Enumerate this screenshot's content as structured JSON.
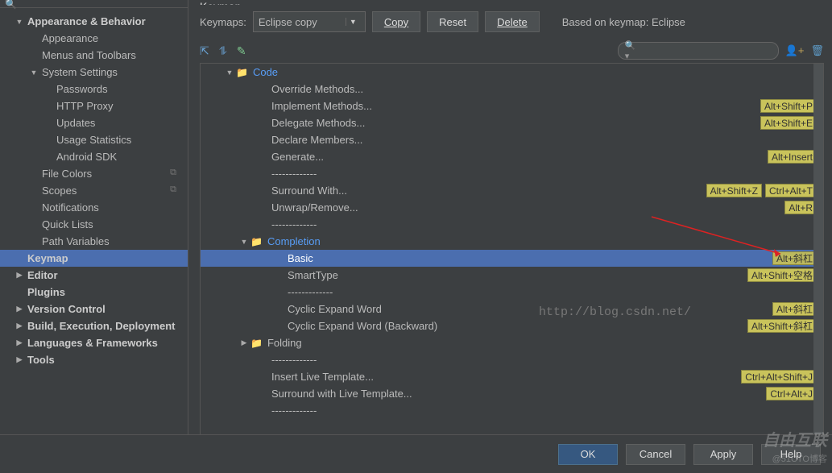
{
  "header": {
    "title": "Keymap"
  },
  "search": {
    "placeholder": ""
  },
  "sidebar": {
    "items": [
      {
        "label": "Appearance & Behavior",
        "indent": 0,
        "arrow": "▼",
        "bold": true
      },
      {
        "label": "Appearance",
        "indent": 1
      },
      {
        "label": "Menus and Toolbars",
        "indent": 1
      },
      {
        "label": "System Settings",
        "indent": 1,
        "arrow": "▼"
      },
      {
        "label": "Passwords",
        "indent": 2
      },
      {
        "label": "HTTP Proxy",
        "indent": 2
      },
      {
        "label": "Updates",
        "indent": 2
      },
      {
        "label": "Usage Statistics",
        "indent": 2
      },
      {
        "label": "Android SDK",
        "indent": 2
      },
      {
        "label": "File Colors",
        "indent": 1,
        "suffix": "⧉"
      },
      {
        "label": "Scopes",
        "indent": 1,
        "suffix": "⧉"
      },
      {
        "label": "Notifications",
        "indent": 1
      },
      {
        "label": "Quick Lists",
        "indent": 1
      },
      {
        "label": "Path Variables",
        "indent": 1
      },
      {
        "label": "Keymap",
        "indent": 0,
        "bold": true,
        "selected": true
      },
      {
        "label": "Editor",
        "indent": 0,
        "arrow": "▶",
        "bold": true
      },
      {
        "label": "Plugins",
        "indent": 0,
        "bold": true
      },
      {
        "label": "Version Control",
        "indent": 0,
        "arrow": "▶",
        "bold": true
      },
      {
        "label": "Build, Execution, Deployment",
        "indent": 0,
        "arrow": "▶",
        "bold": true
      },
      {
        "label": "Languages & Frameworks",
        "indent": 0,
        "arrow": "▶",
        "bold": true
      },
      {
        "label": "Tools",
        "indent": 0,
        "arrow": "▶",
        "bold": true
      }
    ]
  },
  "keymap": {
    "label": "Keymaps:",
    "selected": "Eclipse copy",
    "copy": "Copy",
    "reset": "Reset",
    "delete": "Delete",
    "based": "Based on keymap: Eclipse"
  },
  "toolbelt": {
    "icon1": "⇱",
    "icon2": "⥮",
    "icon3": "✎",
    "filter_icon": "🔍",
    "right_icon1": "👤+",
    "right_icon2": "🗑"
  },
  "actions": [
    {
      "label": "Code",
      "level": 1,
      "arrow": "▼",
      "folder": true,
      "blue": true
    },
    {
      "label": "Override Methods...",
      "level": 3,
      "shortcuts": []
    },
    {
      "label": "Implement Methods...",
      "level": 3,
      "shortcuts": [
        "Alt+Shift+P"
      ]
    },
    {
      "label": "Delegate Methods...",
      "level": 3,
      "shortcuts": [
        "Alt+Shift+E"
      ]
    },
    {
      "label": "Declare Members...",
      "level": 3
    },
    {
      "label": "Generate...",
      "level": 3,
      "shortcuts": [
        "Alt+Insert"
      ]
    },
    {
      "label": "-------------",
      "level": 3
    },
    {
      "label": "Surround With...",
      "level": 3,
      "shortcuts": [
        "Alt+Shift+Z",
        "Ctrl+Alt+T"
      ]
    },
    {
      "label": "Unwrap/Remove...",
      "level": 3,
      "shortcuts": [
        "Alt+R"
      ]
    },
    {
      "label": "-------------",
      "level": 3
    },
    {
      "label": "Completion",
      "level": 2,
      "arrow": "▼",
      "folder": true,
      "blue": true
    },
    {
      "label": "Basic",
      "level": 4,
      "selected": true,
      "shortcuts": [
        "Alt+斜杠"
      ]
    },
    {
      "label": "SmartType",
      "level": 4,
      "shortcuts": [
        "Alt+Shift+空格"
      ]
    },
    {
      "label": "-------------",
      "level": 4
    },
    {
      "label": "Cyclic Expand Word",
      "level": 4,
      "shortcuts": [
        "Alt+斜杠"
      ]
    },
    {
      "label": "Cyclic Expand Word (Backward)",
      "level": 4,
      "shortcuts": [
        "Alt+Shift+斜杠"
      ]
    },
    {
      "label": "Folding",
      "level": 2,
      "arrow": "▶",
      "folder": true
    },
    {
      "label": "-------------",
      "level": 3
    },
    {
      "label": "Insert Live Template...",
      "level": 3,
      "shortcuts": [
        "Ctrl+Alt+Shift+J"
      ]
    },
    {
      "label": "Surround with Live Template...",
      "level": 3,
      "shortcuts": [
        "Ctrl+Alt+J"
      ]
    },
    {
      "label": "-------------",
      "level": 3
    }
  ],
  "watermark": "http://blog.csdn.net/",
  "footer": {
    "ok": "OK",
    "cancel": "Cancel",
    "apply": "Apply",
    "help": "Help"
  },
  "logo": "自由互联",
  "credit": "@51CTO博客"
}
